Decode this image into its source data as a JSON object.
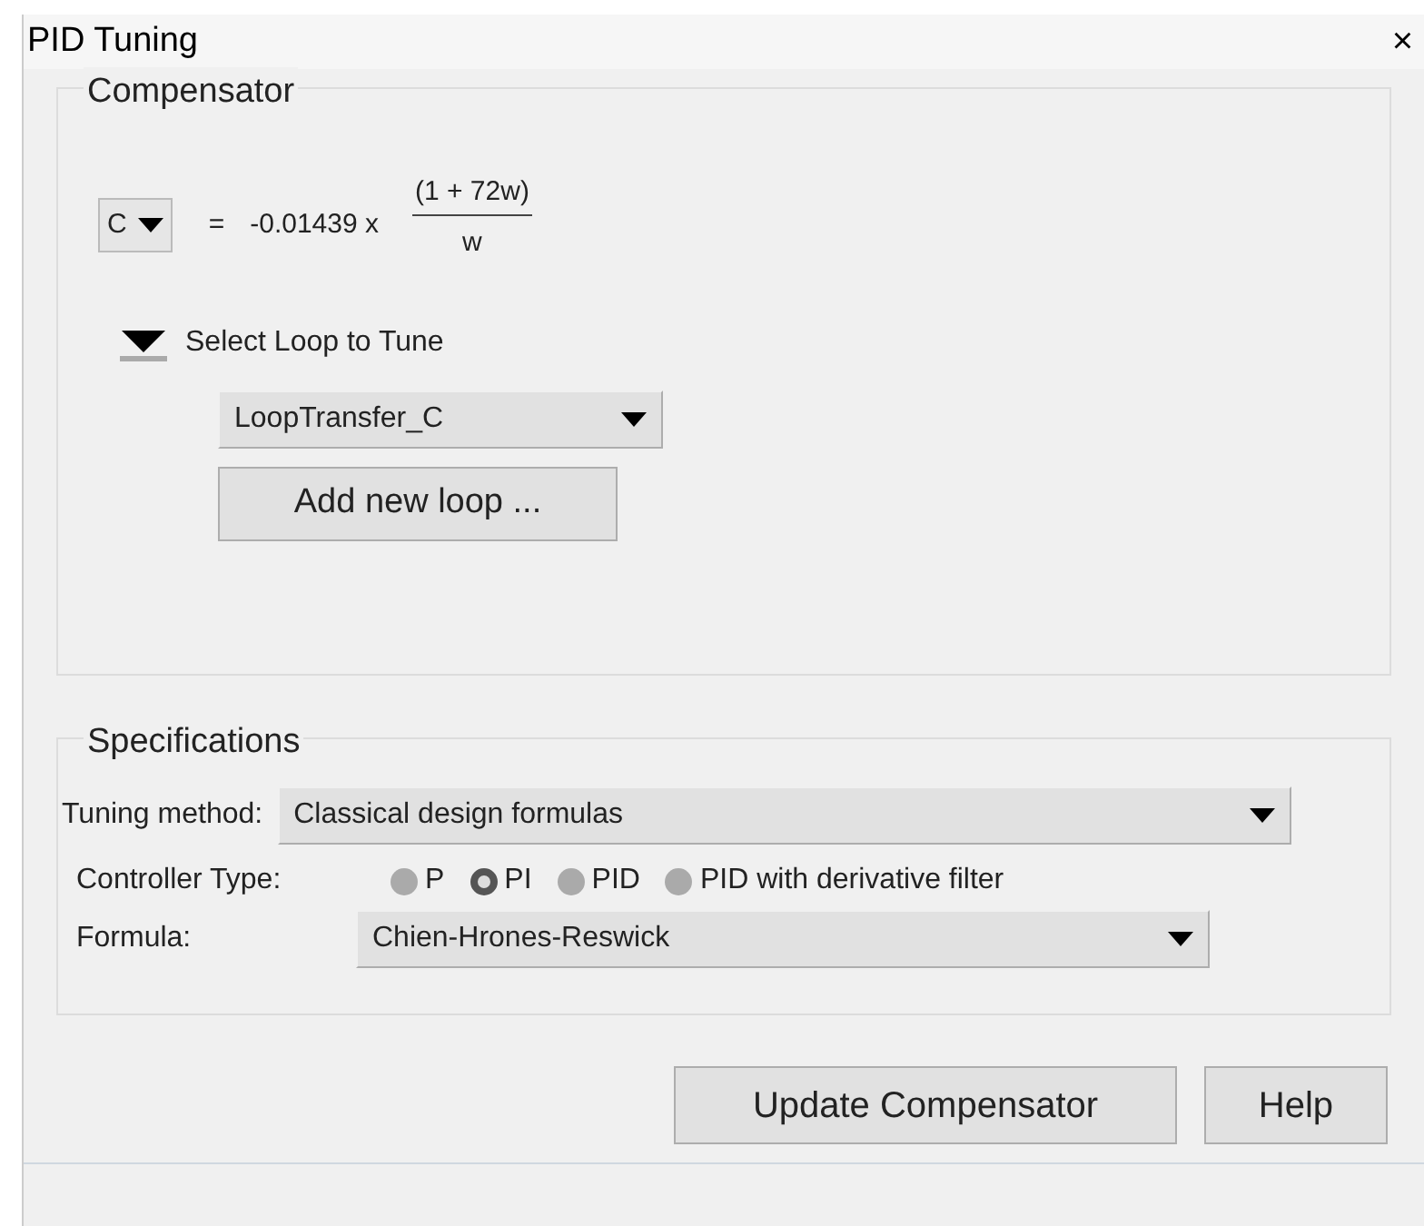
{
  "window": {
    "title": "PID Tuning",
    "close": "×"
  },
  "compensator": {
    "title": "Compensator",
    "block": "C",
    "equals": "=",
    "gain": "-0.01439 x",
    "numerator": "(1 + 72w)",
    "denominator": "w",
    "loop_section": {
      "label": "Select Loop to Tune",
      "expanded": true,
      "loop": "LoopTransfer_C",
      "add_button": "Add new loop ..."
    }
  },
  "specifications": {
    "title": "Specifications",
    "tuning_method_label": "Tuning method:",
    "tuning_method": "Classical design formulas",
    "controller_type_label": "Controller Type:",
    "controller_types": [
      {
        "label": "P",
        "selected": false
      },
      {
        "label": "PI",
        "selected": true
      },
      {
        "label": "PID",
        "selected": false
      },
      {
        "label": "PID with derivative filter",
        "selected": false
      }
    ],
    "formula_label": "Formula:",
    "formula": "Chien-Hrones-Reswick"
  },
  "buttons": [
    "Update Compensator",
    "Help"
  ]
}
